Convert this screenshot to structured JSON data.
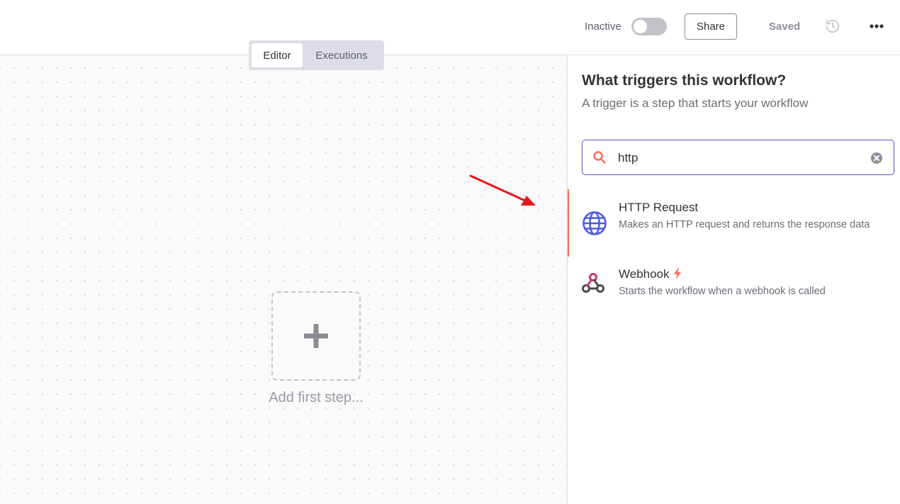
{
  "header": {
    "status_label": "Inactive",
    "share_label": "Share",
    "saved_label": "Saved",
    "history_icon": "history-icon",
    "more_icon": "more-horizontal-icon"
  },
  "canvas": {
    "tabs": [
      {
        "label": "Editor",
        "active": true
      },
      {
        "label": "Executions",
        "active": false
      }
    ],
    "add_step_label": "Add first step..."
  },
  "panel": {
    "title": "What triggers this workflow?",
    "subtitle": "A trigger is a step that starts your workflow",
    "search": {
      "value": "http",
      "placeholder": ""
    },
    "results": [
      {
        "title": "HTTP Request",
        "description": "Makes an HTTP request and returns the response data",
        "icon": "globe-icon",
        "selected": true
      },
      {
        "title": "Webhook",
        "description": "Starts the workflow when a webhook is called",
        "icon": "webhook-icon",
        "trigger_icon": "bolt-icon",
        "selected": false
      }
    ]
  },
  "colors": {
    "accent": "#ff6d5a",
    "focus_border": "#5b4bd8",
    "globe": "#4c5be8",
    "annotation_arrow": "#e8151b"
  }
}
